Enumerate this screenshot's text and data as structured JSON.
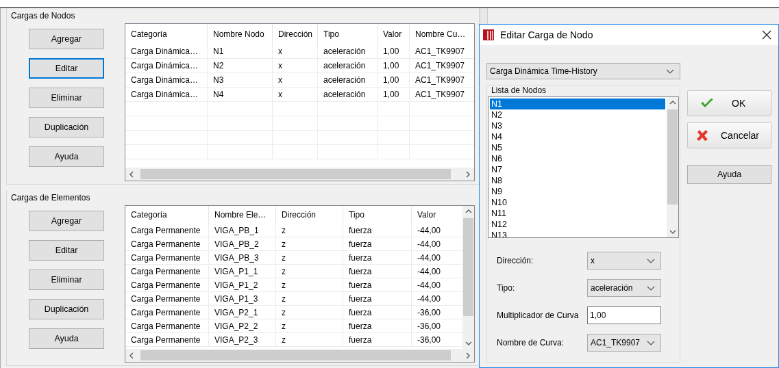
{
  "node_loads": {
    "title": "Cargas de Nodos",
    "buttons": [
      {
        "label": "Agregar",
        "focused": false
      },
      {
        "label": "Editar",
        "focused": true
      },
      {
        "label": "Eliminar",
        "focused": false
      },
      {
        "label": "Duplicación",
        "focused": false
      },
      {
        "label": "Ayuda",
        "focused": false
      }
    ],
    "table": {
      "columns": [
        "Categoría",
        "Nombre Nodo",
        "Dirección",
        "Tipo",
        "Valor",
        "Nombre Cu…"
      ],
      "rows": [
        [
          "Carga Dinámica…",
          "N1",
          "x",
          "aceleración",
          "1,00",
          "AC1_TK9907"
        ],
        [
          "Carga Dinámica…",
          "N2",
          "x",
          "aceleración",
          "1,00",
          "AC1_TK9907"
        ],
        [
          "Carga Dinámica…",
          "N3",
          "x",
          "aceleración",
          "1,00",
          "AC1_TK9907"
        ],
        [
          "Carga Dinámica…",
          "N4",
          "x",
          "aceleración",
          "1,00",
          "AC1_TK9907"
        ]
      ]
    }
  },
  "element_loads": {
    "title": "Cargas de Elementos",
    "buttons": [
      {
        "label": "Agregar",
        "focused": false
      },
      {
        "label": "Editar",
        "focused": false
      },
      {
        "label": "Eliminar",
        "focused": false
      },
      {
        "label": "Duplicación",
        "focused": false
      },
      {
        "label": "Ayuda",
        "focused": false
      }
    ],
    "table": {
      "columns": [
        "Categoría",
        "Nombre Ele…",
        "Dirección",
        "Tipo",
        "Valor"
      ],
      "rows": [
        [
          "Carga Permanente",
          "VIGA_PB_1",
          "z",
          "fuerza",
          "-44,00"
        ],
        [
          "Carga Permanente",
          "VIGA_PB_2",
          "z",
          "fuerza",
          "-44,00"
        ],
        [
          "Carga Permanente",
          "VIGA_PB_3",
          "z",
          "fuerza",
          "-44,00"
        ],
        [
          "Carga Permanente",
          "VIGA_P1_1",
          "z",
          "fuerza",
          "-44,00"
        ],
        [
          "Carga Permanente",
          "VIGA_P1_2",
          "z",
          "fuerza",
          "-44,00"
        ],
        [
          "Carga Permanente",
          "VIGA_P1_3",
          "z",
          "fuerza",
          "-44,00"
        ],
        [
          "Carga Permanente",
          "VIGA_P2_1",
          "z",
          "fuerza",
          "-36,00"
        ],
        [
          "Carga Permanente",
          "VIGA_P2_2",
          "z",
          "fuerza",
          "-36,00"
        ],
        [
          "Carga Permanente",
          "VIGA_P2_3",
          "z",
          "fuerza",
          "-36,00"
        ]
      ]
    }
  },
  "dialog": {
    "title": "Editar Carga de Nodo",
    "category_select": "Carga Dinámica Time-History",
    "node_list": {
      "title": "Lista de Nodos",
      "items": [
        {
          "label": "N1",
          "selected": true
        },
        {
          "label": "N2",
          "selected": false
        },
        {
          "label": "N3",
          "selected": false
        },
        {
          "label": "N4",
          "selected": false
        },
        {
          "label": "N5",
          "selected": false
        },
        {
          "label": "N6",
          "selected": false
        },
        {
          "label": "N7",
          "selected": false
        },
        {
          "label": "N8",
          "selected": false
        },
        {
          "label": "N9",
          "selected": false
        },
        {
          "label": "N10",
          "selected": false
        },
        {
          "label": "N11",
          "selected": false
        },
        {
          "label": "N12",
          "selected": false
        },
        {
          "label": "N13",
          "selected": false
        }
      ]
    },
    "fields": [
      {
        "kind": "select",
        "label": "Dirección:",
        "value": "x"
      },
      {
        "kind": "select",
        "label": "Tipo:",
        "value": "aceleración"
      },
      {
        "kind": "input",
        "label": "Multiplicador de Curva",
        "value": "1,00"
      },
      {
        "kind": "select",
        "label": "Nombre de Curva:",
        "value": "AC1_TK9907"
      }
    ],
    "buttons": [
      {
        "kind": "ok",
        "label": "OK"
      },
      {
        "kind": "cancel",
        "label": "Cancelar"
      },
      {
        "kind": "plain",
        "label": "Ayuda"
      }
    ]
  }
}
